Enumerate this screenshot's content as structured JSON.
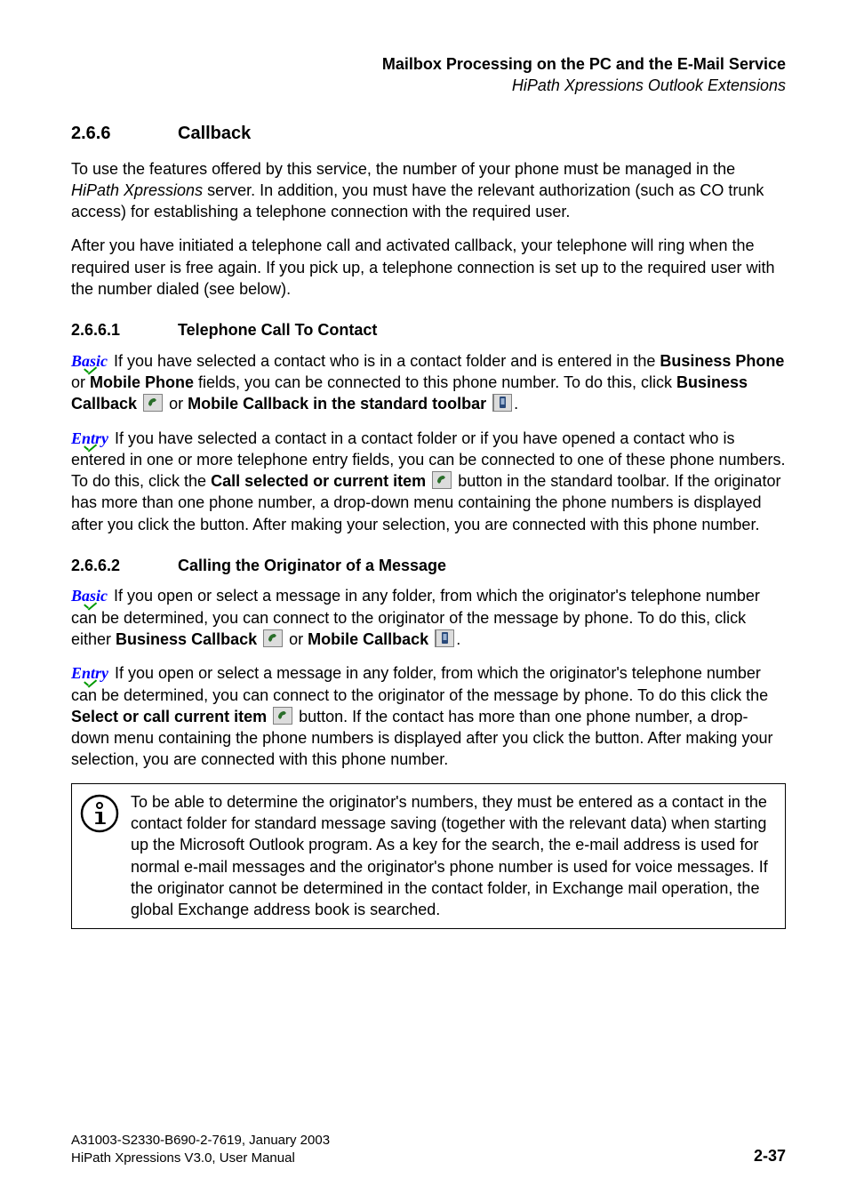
{
  "header": {
    "title": "Mailbox Processing on the PC and the E-Mail Service",
    "subtitle": "HiPath Xpressions Outlook Extensions"
  },
  "section": {
    "number": "2.6.6",
    "title": "Callback"
  },
  "intro": {
    "para1_a": "To use the features offered by this service, the number of your phone must be managed in the ",
    "para1_server": "HiPath Xpressions",
    "para1_b": " server. In addition, you must have the relevant authorization (such as CO trunk access) for establishing a telephone connection with the required user.",
    "para2": "After you have initiated a telephone call and activated callback, your telephone will ring when the required user is free again. If you pick up, a telephone connection is set up to the required user with the number dialed (see below)."
  },
  "sub1": {
    "number": "2.6.6.1",
    "title": "Telephone Call To Contact",
    "basic_label": "Basic",
    "basic_a": " If you have selected a contact who is in a contact folder and is entered in the ",
    "basic_business": "Business Phone",
    "basic_b": " or ",
    "basic_mobile": "Mobile Phone",
    "basic_c": " fields, you can be connected to this phone number. To do this, click ",
    "basic_bcb": "Business Callback",
    "basic_d": " or ",
    "basic_mcb": "Mobile Callback in the standard toolbar",
    "basic_period": ".",
    "entry_label": "Entry",
    "entry_a": " If you have selected a contact in a contact folder or if you have opened a contact who is entered in one or more telephone entry fields, you can be connected to one of these phone numbers. To do this, click the ",
    "entry_btn": "Call selected or current item",
    "entry_b": " button in the standard toolbar. If the originator has more than one phone number, a drop-down menu containing the phone numbers is displayed after you click the button. After making your selection, you are connected with this phone number."
  },
  "sub2": {
    "number": "2.6.6.2",
    "title": "Calling the Originator of a Message",
    "basic_label": "Basic",
    "basic_a": " If you open or select a message in any folder, from which the originator's telephone number can be determined, you can connect to the originator of the message by phone. To do this, click either ",
    "basic_bcb": "Business Callback",
    "basic_b": "  or ",
    "basic_mcb": "Mobile Callback",
    "basic_period": ".",
    "entry_label": "Entry",
    "entry_a": " If you open or select a message in any folder, from which the originator's telephone number can be determined, you can connect to the originator of the message by phone. To do this click the ",
    "entry_btn": "Select or call current item",
    "entry_b": "  button. If the contact has more than one phone number, a drop-down menu containing the phone numbers is displayed after you click the button. After making your selection, you are connected with this phone number."
  },
  "note": {
    "text": "To be able to determine the originator's numbers, they must be entered as a contact in the contact folder for standard message saving (together with the relevant data) when starting up the Microsoft Outlook program. As a key for the search, the e-mail address is used for normal e-mail messages and the originator's phone number is used for voice messages. If the originator cannot be determined in the contact folder, in Exchange mail operation, the global Exchange address book is searched."
  },
  "footer": {
    "line1": "A31003-S2330-B690-2-7619, January 2003",
    "line2": "HiPath Xpressions V3.0, User Manual",
    "page": "2-37"
  }
}
